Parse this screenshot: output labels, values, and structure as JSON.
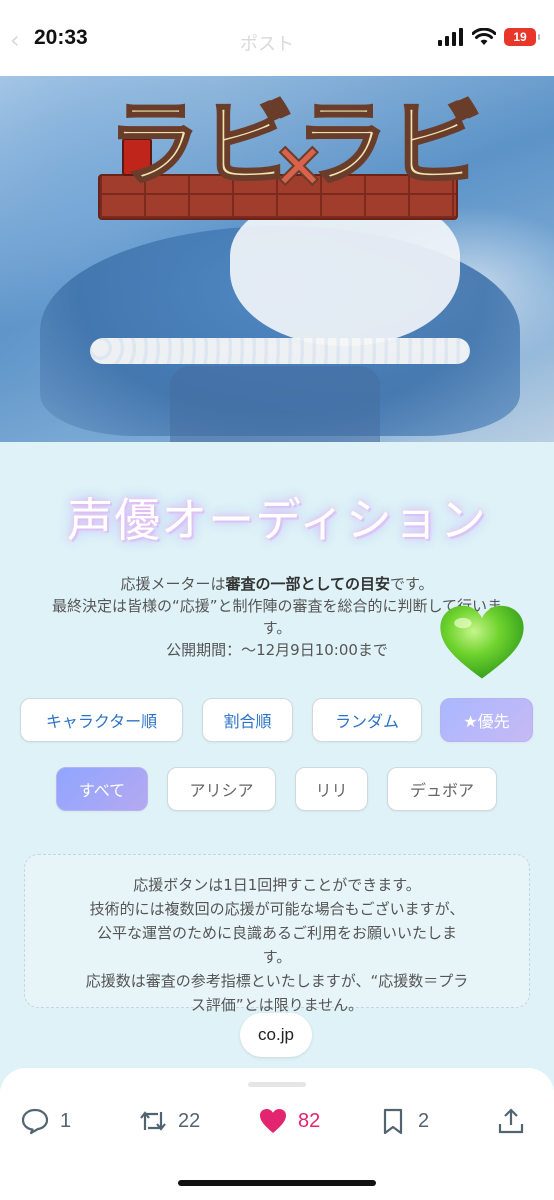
{
  "status_bar": {
    "time": "20:33",
    "ghost_title": "ポスト",
    "battery": "19"
  },
  "hero": {
    "logo_text": "ラビラビ",
    "logo_cross": "×"
  },
  "title": "声優オーディション",
  "note": {
    "line1_pre": "応援メーターは",
    "line1_bold": "審査の一部としての目安",
    "line1_post": "です。",
    "line2": "最終決定は皆様の“応援”と制作陣の審査を総合的に判断して行いま",
    "line3": "す。",
    "line4": "公開期間：〜12月9日10:00まで"
  },
  "sort_buttons": [
    "キャラクター順",
    "割合順",
    "ランダム",
    "★優先"
  ],
  "filter_buttons": [
    "すべて",
    "アリシア",
    "リリ",
    "デュボア"
  ],
  "info": {
    "line1": "応援ボタンは1日1回押すことができます。",
    "line2": "技術的には複数回の応援が可能な場合もございますが、",
    "line3": "公平な運営のために良識あるご利用をお願いいたしま",
    "line4": "す。",
    "line5": "応援数は審査の参考指標といたしますが、“応援数＝プラ",
    "line6": "ス評価”とは限りません。"
  },
  "domain_chip": "co.jp",
  "actions": {
    "replies": "1",
    "reposts": "22",
    "likes": "82",
    "bookmarks": "2"
  },
  "colors": {
    "accent": "#2c73c7",
    "like": "#e3246f",
    "heart": "#5ccf2a"
  }
}
